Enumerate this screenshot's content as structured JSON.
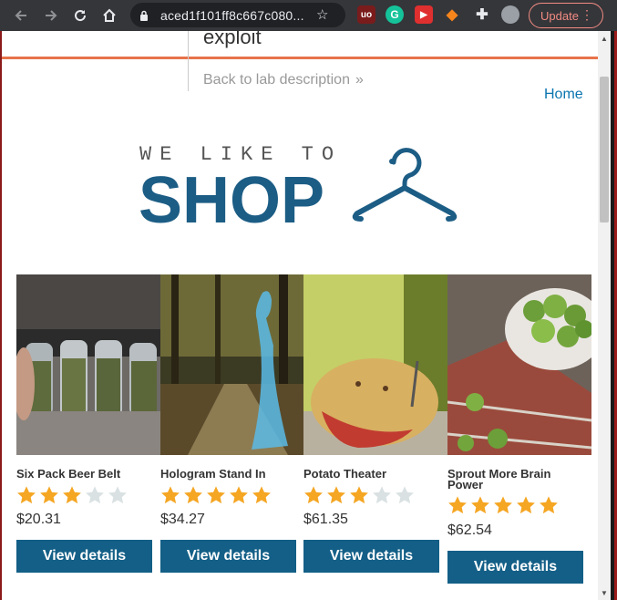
{
  "browser": {
    "url": "aced1f101ff8c667c080...",
    "update_label": "Update",
    "menu_dots": "⋮"
  },
  "lab_header": {
    "title": "exploit",
    "back_link": "Back to lab description",
    "back_chevron": "»"
  },
  "nav": {
    "home": "Home"
  },
  "logo": {
    "tagline": "WE LIKE TO",
    "word": "SHOP"
  },
  "colors": {
    "accent": "#135f87",
    "brand": "#1c5d85",
    "orange": "#e8734a",
    "star": "#f5a623",
    "star_empty": "#d9e1e3"
  },
  "products": [
    {
      "name": "Six Pack Beer Belt",
      "rating": 3,
      "price": "$20.31",
      "button": "View details",
      "image": "beer-belt-image"
    },
    {
      "name": "Hologram Stand In",
      "rating": 5,
      "price": "$34.27",
      "button": "View details",
      "image": "hologram-image"
    },
    {
      "name": "Potato Theater",
      "rating": 3,
      "price": "$61.35",
      "button": "View details",
      "image": "potato-image"
    },
    {
      "name": "Sprout More Brain Power",
      "rating": 5,
      "price": "$62.54",
      "button": "View details",
      "image": "sprouts-image"
    }
  ]
}
